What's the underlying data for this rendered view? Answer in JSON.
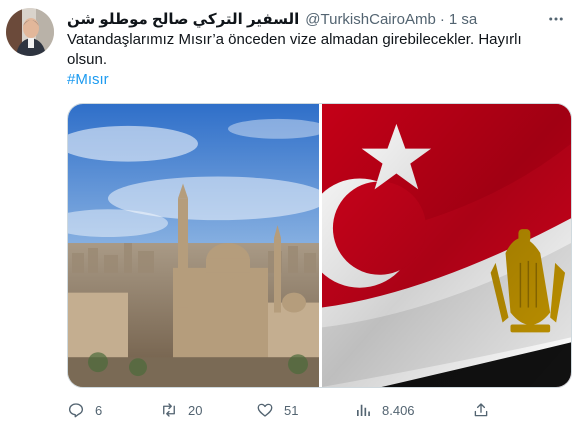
{
  "tweet": {
    "display_name": "السفير التركي صالح موطلو شن",
    "handle": "@TurkishCairoAmb",
    "separator": "·",
    "time": "1 sa",
    "text": "Vatandaşlarımız Mısır’a önceden vize almadan girebilecekler. Hayırlı olsun.",
    "hashtag": "#Mısır"
  },
  "media": {
    "left_image": "cairo-skyline-photo",
    "right_image": "turkey-egypt-flags-photo"
  },
  "actions": {
    "replies": "6",
    "retweets": "20",
    "likes": "51",
    "views": "8.406"
  },
  "colors": {
    "accent": "#1d9bf0",
    "secondary_text": "#536471",
    "turkey_red": "#d0021b",
    "egypt_gold": "#c09300"
  }
}
